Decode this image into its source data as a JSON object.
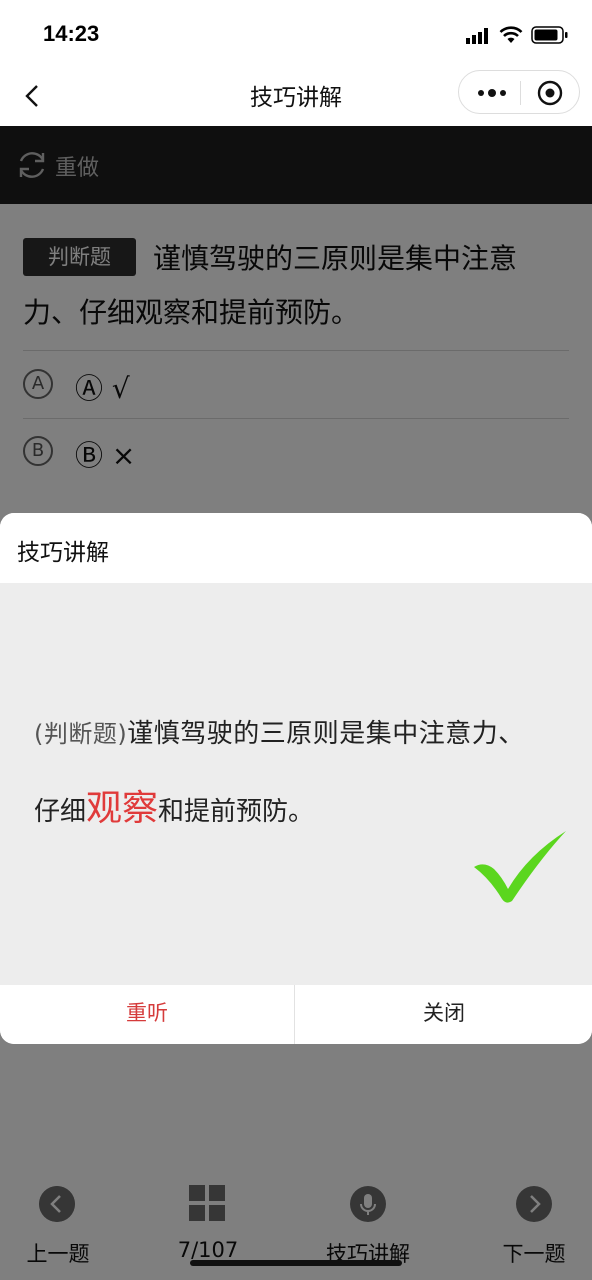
{
  "status_bar": {
    "time": "14:23"
  },
  "nav": {
    "title": "技巧讲解"
  },
  "toolbar": {
    "redo_label": "重做"
  },
  "question": {
    "type_badge": "判断题",
    "text": "谨慎驾驶的三原则是集中注意力、仔细观察和提前预防。",
    "options": [
      {
        "marker": "A",
        "label": "Ⓐ √"
      },
      {
        "marker": "B",
        "label": "Ⓑ ×"
      }
    ]
  },
  "modal": {
    "title": "技巧讲解",
    "explanation": {
      "type_tag": "(判断题)",
      "line1_rest": "谨慎驾驶的三原则是集中注意力、",
      "line2_before": "仔细",
      "line2_highlight": "观察",
      "line2_after": "和提前预防。"
    },
    "replay_label": "重听",
    "close_label": "关闭"
  },
  "bottom_bar": {
    "prev_label": "上一题",
    "progress_label": "7/107",
    "tips_label": "技巧讲解",
    "next_label": "下一题"
  },
  "colors": {
    "highlight": "#e03a3a",
    "check": "#5bd61e",
    "toolbar": "#1f1f1f"
  }
}
